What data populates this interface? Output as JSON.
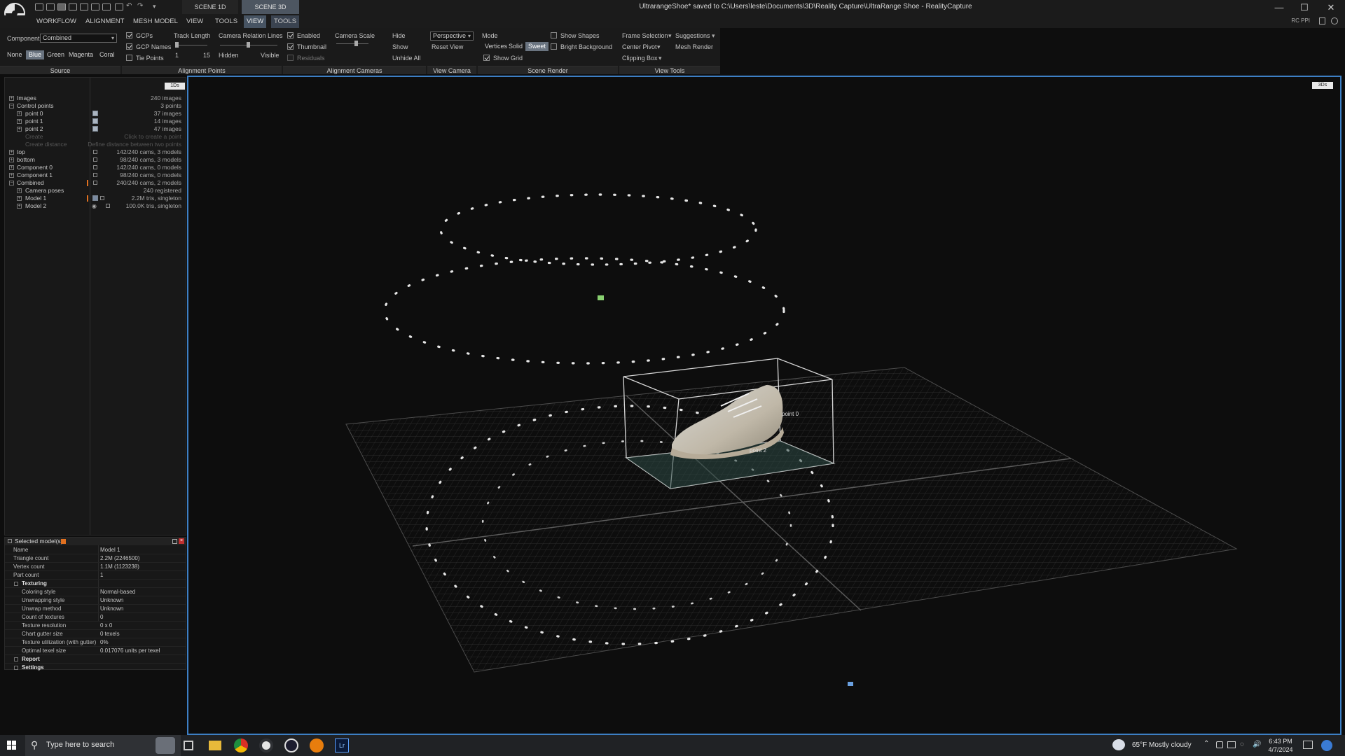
{
  "titlebar": {
    "scene_tabs": [
      "SCENE 1D",
      "SCENE 3D"
    ],
    "title": "UltrarangeShoe* saved to C:\\Users\\leste\\Documents\\3D\\Reality Capture\\UltraRange Shoe - RealityCapture",
    "window_buttons": [
      "—",
      "☐",
      "✕"
    ]
  },
  "menu": {
    "items": [
      "WORKFLOW",
      "ALIGNMENT",
      "MESH MODEL",
      "VIEW",
      "TOOLS",
      "VIEW",
      "TOOLS"
    ],
    "active_index": 5,
    "right_label": "RC PPI"
  },
  "ribbon": {
    "source": {
      "component_label": "Component",
      "component_value": "Combined",
      "colors": [
        "None",
        "Blue",
        "Green",
        "Magenta",
        "Coral"
      ],
      "active_color": "Blue",
      "footer": "Source"
    },
    "alignment_points": {
      "checks": [
        {
          "label": "GCPs",
          "checked": true
        },
        {
          "label": "GCP Names",
          "checked": true
        },
        {
          "label": "Tie Points",
          "checked": false
        }
      ],
      "track_length_label": "Track Length",
      "track_min": "1",
      "track_max": "15",
      "relation_label": "Camera Relation Lines",
      "hidden_label": "Hidden",
      "visible_label": "Visible",
      "footer": "Alignment Points"
    },
    "alignment_cameras": {
      "checks": [
        {
          "label": "Enabled",
          "checked": true
        },
        {
          "label": "Thumbnail",
          "checked": true
        },
        {
          "label": "Residuals",
          "checked": false
        }
      ],
      "scale_label": "Camera Scale",
      "hide_label": "Hide",
      "show_label": "Show",
      "unhide_label": "Unhide All",
      "footer": "Alignment Cameras"
    },
    "view_camera": {
      "projection": "Perspective",
      "reset": "Reset View",
      "footer": "View Camera"
    },
    "scene_render": {
      "mode_label": "Mode",
      "modes": [
        "Vertices",
        "Solid",
        "Sweet"
      ],
      "active_mode": "Sweet",
      "show_grid": "Show Grid",
      "show_shapes": "Show Shapes",
      "bright_background": "Bright Background",
      "footer": "Scene Render"
    },
    "view_tools": {
      "frame_selection": "Frame Selection",
      "suggestions": "Suggestions",
      "center_pivot": "Center Pivot",
      "mesh_render": "Mesh Render",
      "clipping_box": "Clipping Box",
      "footer": "View Tools"
    }
  },
  "tree": {
    "tag": "1Ds",
    "rows": [
      {
        "name": "Images",
        "value": "240 images"
      },
      {
        "name": "Control points",
        "value": "3 points"
      },
      {
        "name": "point 0",
        "value": "37 images"
      },
      {
        "name": "point 1",
        "value": "14 images"
      },
      {
        "name": "point 2",
        "value": "47 images"
      },
      {
        "name": "Create",
        "value": "Click to create a point"
      },
      {
        "name": "Create distance",
        "value": "Define distance between two points"
      },
      {
        "name": "top",
        "value": "142/240 cams, 3 models"
      },
      {
        "name": "bottom",
        "value": "98/240 cams, 3 models"
      },
      {
        "name": "Component 0",
        "value": "142/240 cams, 0 models"
      },
      {
        "name": "Component 1",
        "value": "98/240 cams, 0 models"
      },
      {
        "name": "Combined",
        "value": "240/240 cams, 2 models"
      },
      {
        "name": "Camera poses",
        "value": "240 registered"
      },
      {
        "name": "Model 1",
        "value": "2.2M tris, singleton"
      },
      {
        "name": "Model 2",
        "value": "100.0K tris, singleton"
      }
    ]
  },
  "properties": {
    "title": "Selected model(s)",
    "rows": [
      {
        "k": "Name",
        "v": "Model 1"
      },
      {
        "k": "Triangle count",
        "v": "2.2M (2246500)"
      },
      {
        "k": "Vertex count",
        "v": "1.1M (1123238)"
      },
      {
        "k": "Part count",
        "v": "1"
      },
      {
        "k": "Texturing",
        "v": ""
      },
      {
        "k": "Coloring style",
        "v": "Normal-based"
      },
      {
        "k": "Unwrapping style",
        "v": "Unknown"
      },
      {
        "k": "Unwrap method",
        "v": "Unknown"
      },
      {
        "k": "Count of textures",
        "v": "0"
      },
      {
        "k": "Texture resolution",
        "v": "0 x 0"
      },
      {
        "k": "Chart gutter size",
        "v": "0 texels"
      },
      {
        "k": "Texture utilization (with gutter)",
        "v": "0%"
      },
      {
        "k": "Optimal texel size",
        "v": "0.017076 units per texel"
      },
      {
        "k": "Report",
        "v": ""
      },
      {
        "k": "Settings",
        "v": ""
      }
    ]
  },
  "viewport": {
    "tag": "3Ds",
    "point_labels": [
      "point 0",
      "point 2"
    ]
  },
  "taskbar": {
    "search_placeholder": "Type here to search",
    "weather": "65°F  Mostly cloudy",
    "time": "6:43 PM",
    "date": "4/7/2024"
  },
  "colors": {
    "accent": "#3d7fc4",
    "active_tab": "#475463",
    "orange": "#e07020"
  }
}
